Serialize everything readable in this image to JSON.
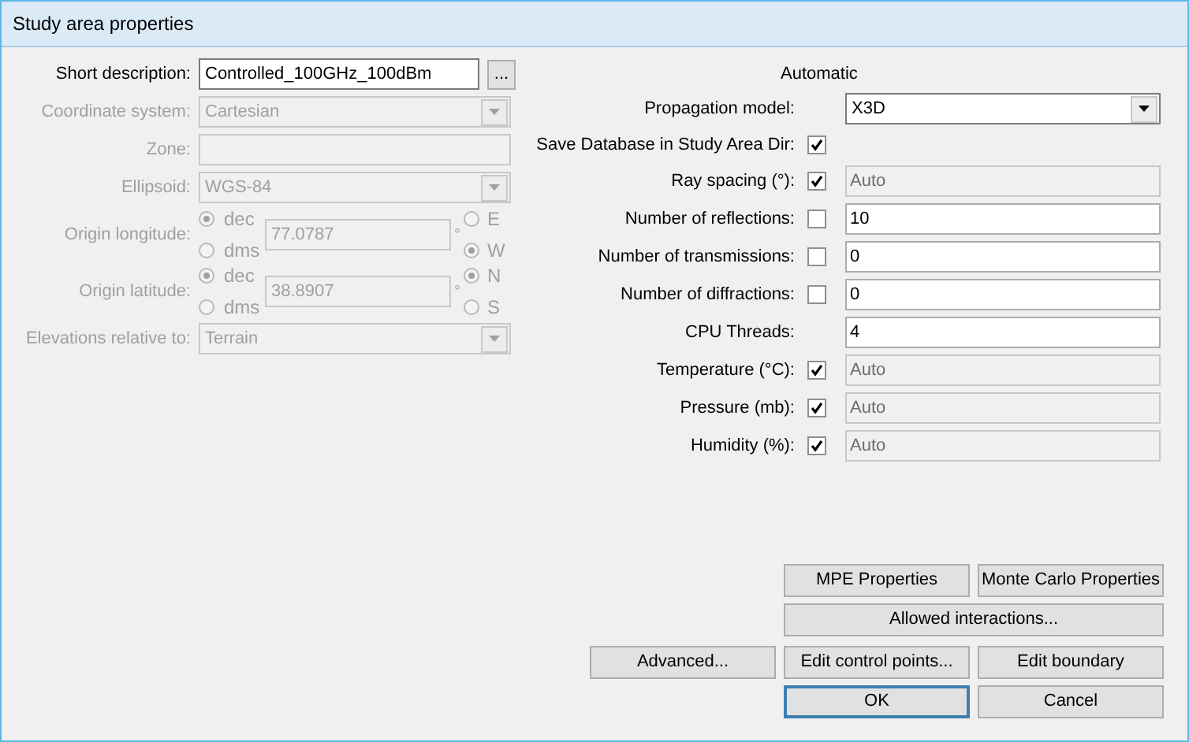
{
  "window": {
    "title": "Study area properties"
  },
  "left_fields": [
    {
      "kind": "text",
      "label": "Short description:",
      "value": "Controlled_100GHz_100dBm",
      "disabled": false,
      "browse": "..."
    },
    {
      "kind": "select",
      "label": "Coordinate system:",
      "value": "Cartesian",
      "disabled": true
    },
    {
      "kind": "text",
      "label": "Zone:",
      "disabled": true
    },
    {
      "kind": "select",
      "label": "Ellipsoid:",
      "value": "WGS-84",
      "disabled": true
    },
    {
      "kind": "coord",
      "label": "Origin longitude:",
      "disabled": true,
      "formats": [
        {
          "label": "dec",
          "selected": true
        },
        {
          "label": "dms",
          "selected": false
        }
      ],
      "value": "77.0787",
      "degree": "°",
      "hemispheres": [
        {
          "label": "E",
          "selected": false
        },
        {
          "label": "W",
          "selected": true
        }
      ]
    },
    {
      "kind": "coord",
      "label": "Origin latitude:",
      "disabled": true,
      "formats": [
        {
          "label": "dec",
          "selected": true
        },
        {
          "label": "dms",
          "selected": false
        }
      ],
      "value": "38.8907",
      "degree": "°",
      "hemispheres": [
        {
          "label": "N",
          "selected": true
        },
        {
          "label": "S",
          "selected": false
        }
      ]
    },
    {
      "kind": "select",
      "label": "Elevations relative to:",
      "value": "Terrain",
      "disabled": true
    }
  ],
  "right_heading": "Automatic",
  "right_fields": [
    {
      "kind": "select",
      "label": "Propagation model:",
      "value": "X3D"
    },
    {
      "kind": "check",
      "label": "Save Database in Study Area Dir:",
      "checked": true
    },
    {
      "kind": "check_field",
      "label": "Ray spacing (°):",
      "checked": true,
      "value": "Auto"
    },
    {
      "kind": "check_field",
      "label": "Number of reflections:",
      "checked": false,
      "value": "10"
    },
    {
      "kind": "check_field",
      "label": "Number of transmissions:",
      "checked": false,
      "value": "0"
    },
    {
      "kind": "check_field",
      "label": "Number of diffractions:",
      "checked": false,
      "value": "0"
    },
    {
      "kind": "field",
      "label": "CPU Threads:",
      "value": "4"
    },
    {
      "kind": "check_field",
      "label": "Temperature (°C):",
      "checked": true,
      "value": "Auto"
    },
    {
      "kind": "check_field",
      "label": "Pressure (mb):",
      "checked": true,
      "value": "Auto"
    },
    {
      "kind": "check_field",
      "label": "Humidity (%):",
      "checked": true,
      "value": "Auto"
    }
  ],
  "buttons": {
    "mpe": "MPE Properties",
    "monte_carlo": "Monte Carlo Properties",
    "allowed": "Allowed interactions...",
    "advanced": "Advanced...",
    "control_points": "Edit control points...",
    "boundary": "Edit boundary",
    "ok": "OK",
    "cancel": "Cancel"
  }
}
